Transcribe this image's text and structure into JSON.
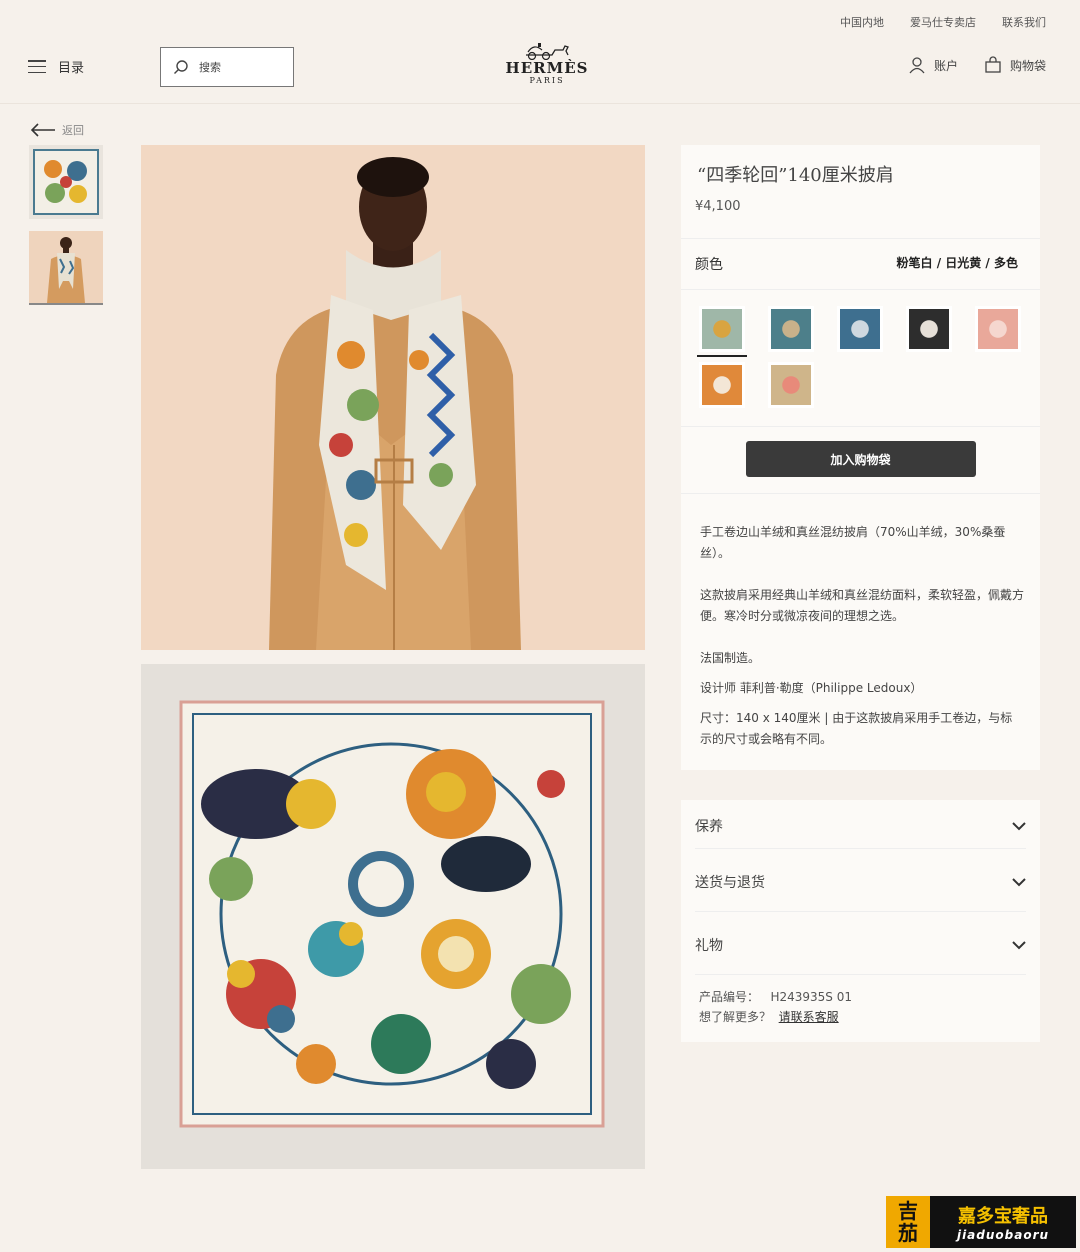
{
  "top_links": [
    "中国内地",
    "爱马仕专卖店",
    "联系我们"
  ],
  "header": {
    "menu_label": "目录",
    "search_placeholder": "搜索",
    "logo_name": "HERMÈS",
    "logo_city": "PARIS",
    "account_label": "账户",
    "bag_label": "购物袋"
  },
  "back_label": "返回",
  "product": {
    "title": "“四季轮回”140厘米披肩",
    "price": "¥4,100",
    "color_label": "颜色",
    "color_selected": "粉笔白 / 日光黄 / 多色",
    "swatches": [
      {
        "color": "#9fb7a8",
        "accent": "#d9a441"
      },
      {
        "color": "#4d7f8a",
        "accent": "#c9b18a"
      },
      {
        "color": "#3e6f8f",
        "accent": "#cfd8df"
      },
      {
        "color": "#2d2d2d",
        "accent": "#e6e0d8"
      },
      {
        "color": "#e9a89a",
        "accent": "#f5d7cf"
      },
      {
        "color": "#e0893a",
        "accent": "#f3e6d6"
      },
      {
        "color": "#cfb58a",
        "accent": "#e88a7a"
      }
    ],
    "add_to_cart": "加入购物袋",
    "description": [
      "手工卷边山羊绒和真丝混纺披肩（70%山羊绒，30%桑蚕丝）。",
      "这款披肩采用经典山羊绒和真丝混纺面料，柔软轻盈，佩戴方便。寒冷时分或微凉夜间的理想之选。",
      "法国制造。",
      "设计师 菲利普·勒度（Philippe Ledoux）",
      "尺寸：140 x 140厘米 | 由于这款披肩采用手工卷边，与标示的尺寸或会略有不同。"
    ],
    "accordions": [
      "保养",
      "送货与退货",
      "礼物"
    ],
    "sku_label": "产品编号：",
    "sku": "H243935S 01",
    "help_label": "想了解更多？",
    "help_link": "请联系客服"
  },
  "watermark": {
    "seal_top": "吉",
    "seal_bottom": "茄",
    "cn": "嘉多宝奢品",
    "en": "jiaduobaoru"
  },
  "colors": {
    "background": "#f6f1eb",
    "panel": "#fcfaf7",
    "button": "#3a3a3a"
  }
}
